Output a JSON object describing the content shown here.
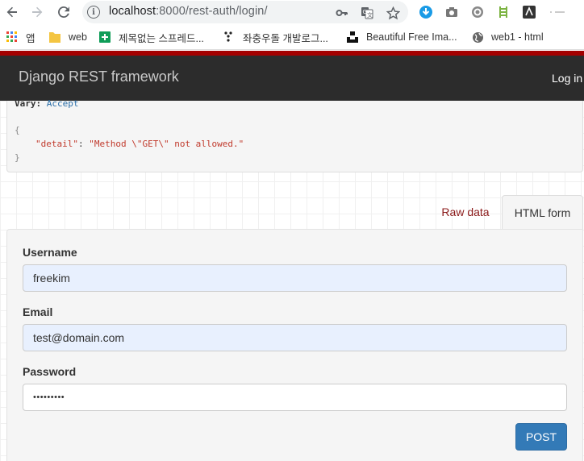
{
  "browser": {
    "url_host": "localhost",
    "url_path": ":8000/rest-auth/login/"
  },
  "bookmarks": [
    {
      "label": "앱",
      "icon": "apps-grid-icon"
    },
    {
      "label": "web",
      "icon": "folder-icon"
    },
    {
      "label": "제목없는 스프레드...",
      "icon": "sheets-icon"
    },
    {
      "label": "좌충우돌 개발로그...",
      "icon": "dots-icon"
    },
    {
      "label": "Beautiful Free Ima...",
      "icon": "unsplash-icon"
    },
    {
      "label": "web1 - html",
      "icon": "globe-icon"
    }
  ],
  "navbar": {
    "brand": "Django REST framework",
    "login": "Log in"
  },
  "response": {
    "header_key": "Vary:",
    "header_value": "Accept",
    "open_brace": "{",
    "detail_key": "\"detail\"",
    "colon": ": ",
    "detail_value": "\"Method \\\"GET\\\" not allowed.\"",
    "close_brace": "}"
  },
  "tabs": {
    "raw": "Raw data",
    "html": "HTML form"
  },
  "form": {
    "username_label": "Username",
    "username_value": "freekim",
    "email_label": "Email",
    "email_value": "test@domain.com",
    "password_label": "Password",
    "password_value": "•••••••••",
    "submit": "POST"
  },
  "colors": {
    "navbar": "#2c2c2c",
    "accent_strip": "#a30000",
    "post_button": "#337ab7",
    "autofill": "#e8f0fe"
  }
}
